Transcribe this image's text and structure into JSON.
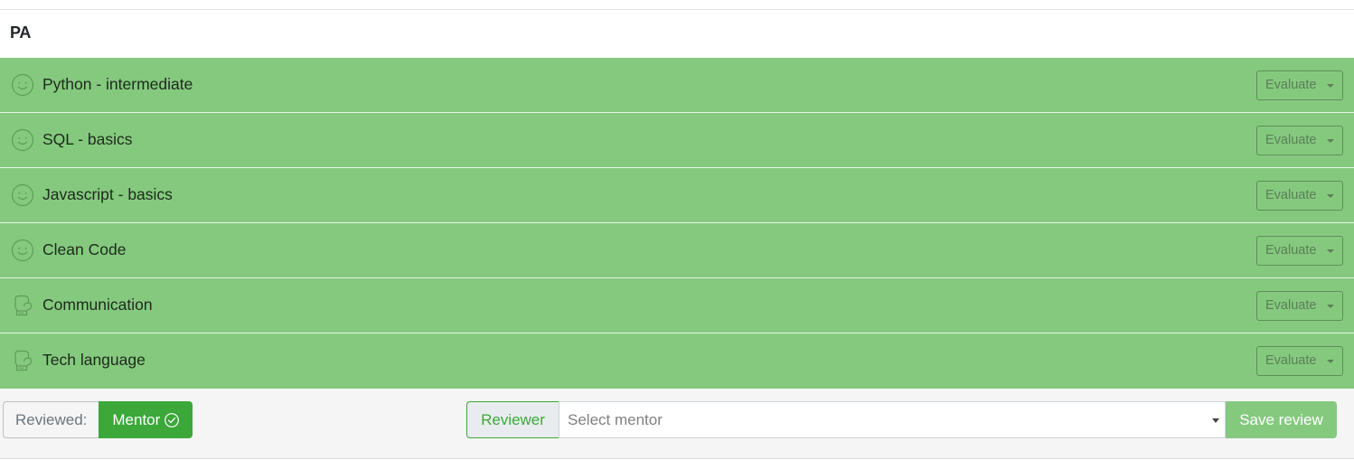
{
  "section": {
    "title": "PA"
  },
  "skills": [
    {
      "label": "Python - intermediate",
      "icon": "smile-icon"
    },
    {
      "label": "SQL - basics",
      "icon": "smile-icon"
    },
    {
      "label": "Javascript - basics",
      "icon": "smile-icon"
    },
    {
      "label": "Clean Code",
      "icon": "smile-icon"
    },
    {
      "label": "Communication",
      "icon": "boxing-glove-icon"
    },
    {
      "label": "Tech language",
      "icon": "boxing-glove-icon"
    }
  ],
  "evaluate_label": "Evaluate",
  "footer": {
    "reviewed_label": "Reviewed:",
    "mentor_label": "Mentor",
    "reviewer_label": "Reviewer",
    "select_placeholder": "Select mentor",
    "save_label": "Save review"
  },
  "colors": {
    "row_bg": "#85c97f",
    "accent_green": "#3ca83a",
    "footer_bg": "#f5f5f5"
  }
}
